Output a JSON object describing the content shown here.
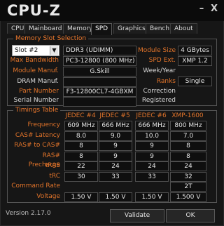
{
  "window": {
    "title": "CPU-Z",
    "minimize_label": "–",
    "close_label": "X"
  },
  "tabs": [
    "CPU",
    "Mainboard",
    "Memory",
    "SPD",
    "Graphics",
    "Bench",
    "About"
  ],
  "active_tab": "SPD",
  "memory_slot": {
    "group_title": "Memory Slot Selection",
    "slot_selected": "Slot #2",
    "type": "DDR3 (UDIMM)",
    "max_bandwidth_label": "Max Bandwidth",
    "max_bandwidth": "PC3-12800 (800 MHz)",
    "module_manuf_label": "Module Manuf.",
    "module_manuf": "G.Skill",
    "dram_manuf_label": "DRAM Manuf.",
    "dram_manuf": "",
    "part_number_label": "Part Number",
    "part_number": "F3-12800CL7-4GBXM",
    "serial_number_label": "Serial Number",
    "serial_number": "",
    "module_size_label": "Module Size",
    "module_size": "4 GBytes",
    "spd_ext_label": "SPD Ext.",
    "spd_ext": "XMP 1.2",
    "week_year_label": "Week/Year",
    "week_year": "",
    "ranks_label": "Ranks",
    "ranks": "Single",
    "correction_label": "Correction",
    "correction": "",
    "registered_label": "Registered",
    "registered": ""
  },
  "timings": {
    "group_title": "Timings Table",
    "columns": [
      "JEDEC #4",
      "JEDEC #5",
      "JEDEC #6",
      "XMP-1600"
    ],
    "rows": [
      {
        "label": "Frequency",
        "values": [
          "609 MHz",
          "666 MHz",
          "666 MHz",
          "800 MHz"
        ]
      },
      {
        "label": "CAS# Latency",
        "values": [
          "8.0",
          "9.0",
          "10.0",
          "7.0"
        ]
      },
      {
        "label": "RAS# to CAS#",
        "values": [
          "8",
          "9",
          "9",
          "8"
        ]
      },
      {
        "label": "RAS# Precharge",
        "values": [
          "8",
          "9",
          "9",
          "8"
        ]
      },
      {
        "label": "tRAS",
        "values": [
          "22",
          "24",
          "24",
          "24"
        ]
      },
      {
        "label": "tRC",
        "values": [
          "30",
          "33",
          "33",
          "32"
        ]
      },
      {
        "label": "Command Rate",
        "values": [
          "",
          "",
          "",
          "2T"
        ]
      },
      {
        "label": "Voltage",
        "values": [
          "1.50 V",
          "1.50 V",
          "1.50 V",
          "1.500 V"
        ]
      }
    ]
  },
  "footer": {
    "version": "Version 2.17.0",
    "validate_label": "Validate",
    "ok_label": "OK"
  },
  "colors": {
    "accent": "#e0732a",
    "background": "#161616"
  }
}
